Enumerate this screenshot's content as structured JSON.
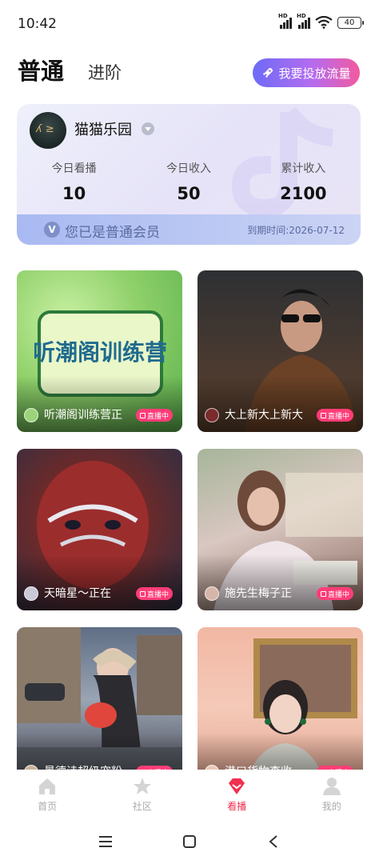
{
  "status_bar": {
    "time": "10:42",
    "signal1": "HD",
    "signal2": "HD",
    "battery": "40"
  },
  "header": {
    "tab_active": "普通",
    "tab_inactive": "进阶",
    "promo_button": "我要投放流量"
  },
  "member_card": {
    "nickname": "猫猫乐园",
    "stats": [
      {
        "label": "今日看播",
        "value": "10"
      },
      {
        "label": "今日收入",
        "value": "50"
      },
      {
        "label": "累计收入",
        "value": "2100"
      }
    ],
    "vip_text": "您已是普通会员",
    "expire_text": "到期时间:2026-07-12"
  },
  "streams": [
    {
      "title": "听潮阁训练营正",
      "badge": "直播中",
      "poster_title": "听潮阁训练营"
    },
    {
      "title": "大上新大上新大",
      "badge": "直播中"
    },
    {
      "title": "天暗星～正在",
      "badge": "直播中"
    },
    {
      "title": "施先生梅子正",
      "badge": "直播中"
    },
    {
      "title": "景德诗超级宠粉",
      "badge": "直播中"
    },
    {
      "title": "港口货物李收",
      "badge": "直播中"
    }
  ],
  "bottom_nav": [
    {
      "label": "首页",
      "icon": "home-icon",
      "active": false
    },
    {
      "label": "社区",
      "icon": "star-icon",
      "active": false
    },
    {
      "label": "看播",
      "icon": "diamond-icon",
      "active": true
    },
    {
      "label": "我的",
      "icon": "user-icon",
      "active": false
    }
  ],
  "colors": {
    "accent": "#f1304f",
    "live_badge": "#ff3d78",
    "promo_start": "#6d6bf7",
    "promo_end": "#f25aa0"
  }
}
